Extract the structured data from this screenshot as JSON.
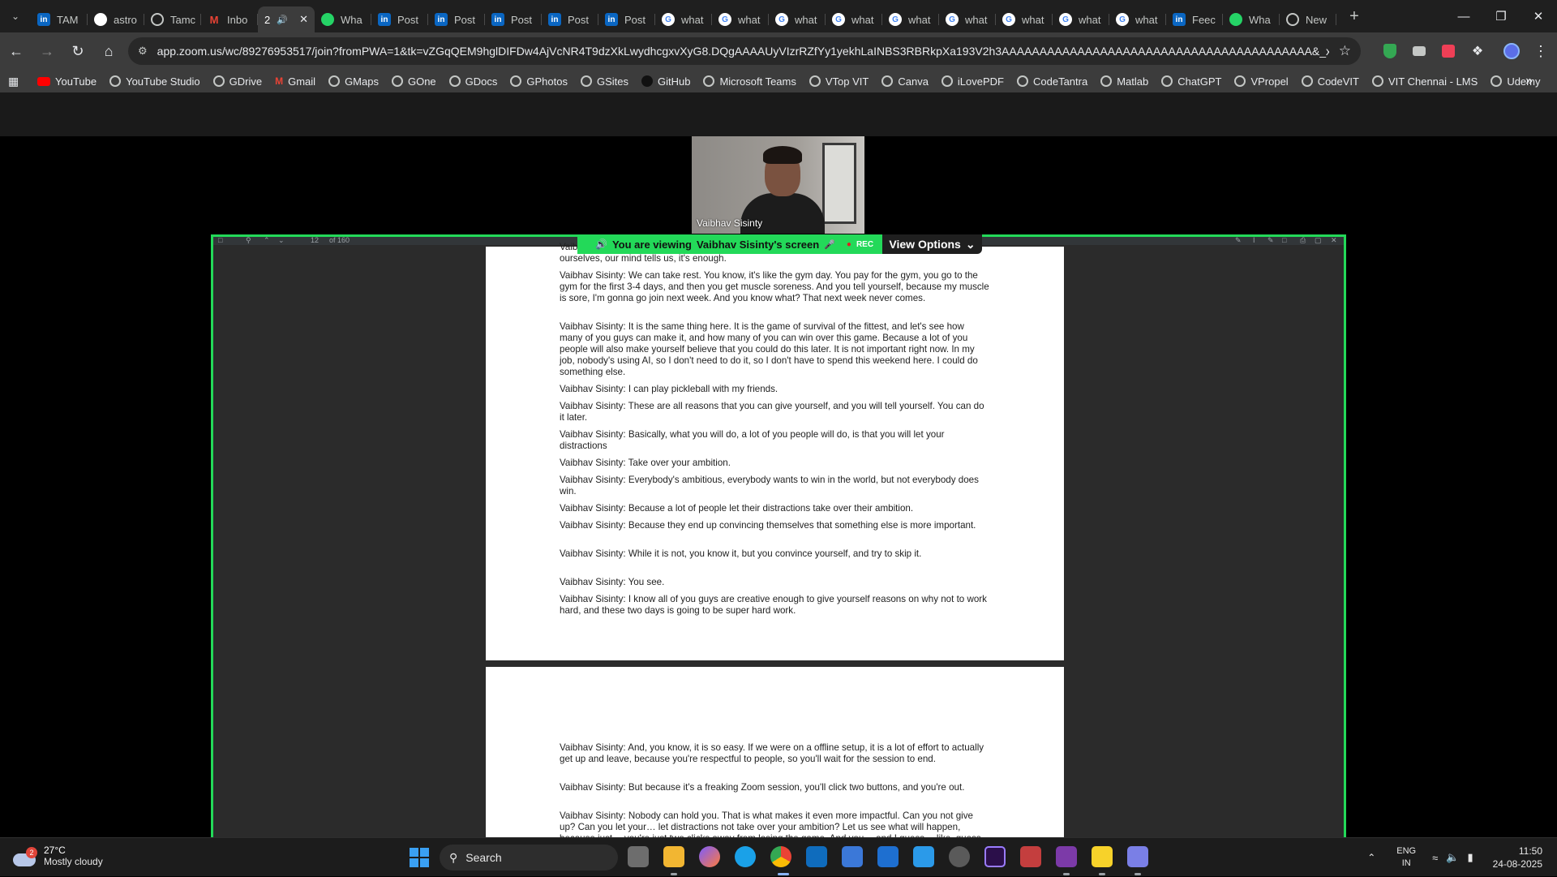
{
  "tabs": [
    {
      "label": "TAM",
      "icon": "linkedin-icon",
      "kind": "li"
    },
    {
      "label": "astro",
      "icon": "github-icon",
      "kind": "gh"
    },
    {
      "label": "Tamc",
      "icon": "globe-icon",
      "kind": "globe"
    },
    {
      "label": "Inbo",
      "icon": "gmail-icon",
      "kind": "gm"
    },
    {
      "label": "2",
      "icon": "zoom-icon",
      "kind": "active"
    },
    {
      "label": "Wha",
      "icon": "whatsapp-icon",
      "kind": "wa"
    },
    {
      "label": "Post",
      "icon": "linkedin-icon",
      "kind": "li"
    },
    {
      "label": "Post",
      "icon": "linkedin-icon",
      "kind": "li"
    },
    {
      "label": "Post",
      "icon": "linkedin-icon",
      "kind": "li"
    },
    {
      "label": "Post",
      "icon": "linkedin-icon",
      "kind": "li"
    },
    {
      "label": "Post",
      "icon": "linkedin-icon",
      "kind": "li"
    },
    {
      "label": "what",
      "icon": "google-icon",
      "kind": "g"
    },
    {
      "label": "what",
      "icon": "google-icon",
      "kind": "g"
    },
    {
      "label": "what",
      "icon": "google-icon",
      "kind": "g"
    },
    {
      "label": "what",
      "icon": "google-icon",
      "kind": "g"
    },
    {
      "label": "what",
      "icon": "google-icon",
      "kind": "g"
    },
    {
      "label": "what",
      "icon": "google-icon",
      "kind": "g"
    },
    {
      "label": "what",
      "icon": "google-icon",
      "kind": "g"
    },
    {
      "label": "what",
      "icon": "google-icon",
      "kind": "g"
    },
    {
      "label": "what",
      "icon": "google-icon",
      "kind": "g"
    },
    {
      "label": "Feec",
      "icon": "linkedin-icon",
      "kind": "li"
    },
    {
      "label": "Wha",
      "icon": "whatsapp-icon",
      "kind": "wa"
    },
    {
      "label": "New",
      "icon": "chrome-icon",
      "kind": "globe"
    }
  ],
  "address_bar": {
    "url": "app.zoom.us/wc/89276953517/join?fromPWA=1&tk=vZGqQEM9hglDIFDw4AjVcNR4T9dzXkLwydhcgxvXyG8.DQgAAAAUyVIzrRZfYy1yekhLaINBS3RBRkpXa193V2h3AAAAAAAAAAAAAAAAAAAAAAAAAAAAAAAAAAAAAAAAA&_x_zm_r..."
  },
  "bookmarks": [
    {
      "label": "YouTube",
      "kind": "yt"
    },
    {
      "label": "YouTube Studio",
      "kind": "globe"
    },
    {
      "label": "GDrive",
      "kind": "globe"
    },
    {
      "label": "Gmail",
      "kind": "gm"
    },
    {
      "label": "GMaps",
      "kind": "globe"
    },
    {
      "label": "GOne",
      "kind": "globe"
    },
    {
      "label": "GDocs",
      "kind": "globe"
    },
    {
      "label": "GPhotos",
      "kind": "globe"
    },
    {
      "label": "GSites",
      "kind": "globe"
    },
    {
      "label": "GitHub",
      "kind": "gh"
    },
    {
      "label": "Microsoft Teams",
      "kind": "globe"
    },
    {
      "label": "VTop VIT",
      "kind": "globe"
    },
    {
      "label": "Canva",
      "kind": "globe"
    },
    {
      "label": "iLovePDF",
      "kind": "globe"
    },
    {
      "label": "CodeTantra",
      "kind": "globe"
    },
    {
      "label": "Matlab",
      "kind": "globe"
    },
    {
      "label": "ChatGPT",
      "kind": "globe"
    },
    {
      "label": "VPropel",
      "kind": "globe"
    },
    {
      "label": "CodeVIT",
      "kind": "globe"
    },
    {
      "label": "VIT Chennai - LMS",
      "kind": "globe"
    },
    {
      "label": "Udemy",
      "kind": "globe"
    }
  ],
  "zoom": {
    "participant_name": "Vaibhav Sisinty",
    "banner_prefix": "You are viewing",
    "banner_owner": "Vaibhav Sisinty's screen",
    "rec_label": "REC",
    "view_options_label": "View Options",
    "pdf_page_number": "12",
    "pdf_page_total": "of 160"
  },
  "pdf": {
    "page1_paragraphs": [
      "Vaibhav Sisinty: And I think these are all tricks that our mind plays with us. Every time we push ourselves, our mind tells us, it's enough.",
      "Vaibhav Sisinty: We can take rest. You know, it's like the gym day. You pay for the gym, you go to the gym for the first 3-4 days, and then you get muscle soreness. And you tell yourself, because my muscle is sore, I'm gonna go join next week. And you know what? That next week never comes.",
      "Vaibhav Sisinty: It is the same thing here. It is the game of survival of the fittest, and let's see how many of you guys can make it, and how many of you can win over this game. Because a lot of you people will also make yourself believe that you could do this later. It is not important right now. In my job, nobody's using AI, so I don't need to do it, so I don't have to spend this weekend here. I could do something else.",
      "Vaibhav Sisinty: I can play pickleball with my friends.",
      "Vaibhav Sisinty: These are all reasons that you can give yourself, and you will tell yourself. You can do it later.",
      "Vaibhav Sisinty: Basically, what you will do, a lot of you people will do, is that you will let your distractions",
      "Vaibhav Sisinty: Take over your ambition.",
      "Vaibhav Sisinty: Everybody's ambitious, everybody wants to win in the world, but not everybody does win.",
      "Vaibhav Sisinty: Because a lot of people let their distractions take over their ambition.",
      "Vaibhav Sisinty: Because they end up convincing themselves that something else is more important.",
      "Vaibhav Sisinty: While it is not, you know it, but you convince yourself, and try to skip it.",
      "Vaibhav Sisinty: You see.",
      "Vaibhav Sisinty: I know all of you guys are creative enough to give yourself reasons on why not to work hard, and these two days is going to be super hard work."
    ],
    "page2_paragraphs": [
      "Vaibhav Sisinty: And, you know, it is so easy. If we were on a offline setup, it is a lot of effort to actually get up and leave, because you're respectful to people, so you'll wait for the session to end.",
      "Vaibhav Sisinty: But because it's a freaking Zoom session, you'll click two buttons, and you're out.",
      "Vaibhav Sisinty: Nobody can hold you. That is what makes it even more impactful. Can you not give up? Can you let your… let distractions not take over your ambition? Let us see what will happen, because just… you're just two clicks away from losing the game. And you… and I guess… like, guess what? Like, as I think a lot about all of this, right, while I've been telling these people that it's not easy,"
    ]
  },
  "taskbar": {
    "weather_badge": "2",
    "weather_temp": "27°C",
    "weather_desc": "Mostly cloudy",
    "search_label": "Search",
    "lang_1": "ENG",
    "lang_2": "IN",
    "time": "11:50",
    "date": "24-08-2025"
  }
}
